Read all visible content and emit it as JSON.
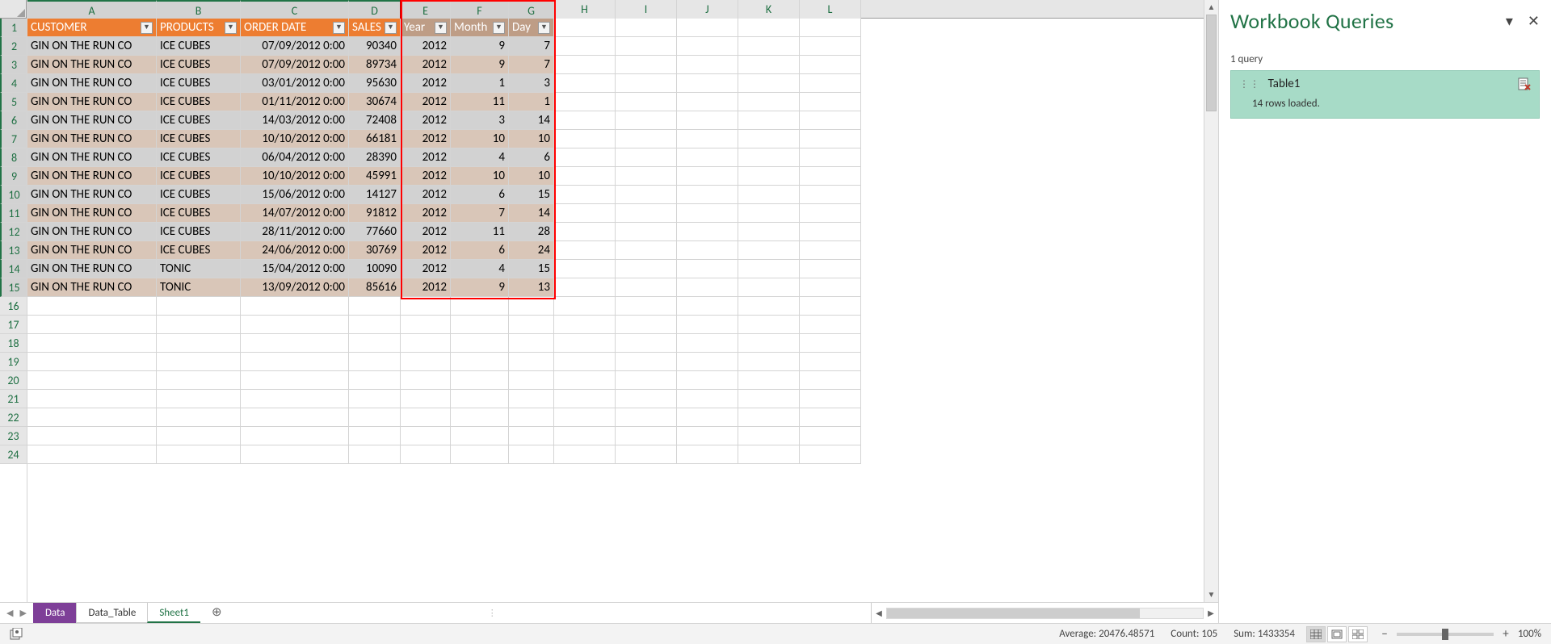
{
  "columns_labeled": [
    "A",
    "B",
    "C",
    "D",
    "E",
    "F",
    "G",
    "H",
    "I",
    "J",
    "K",
    "L"
  ],
  "row_numbers": [
    1,
    2,
    3,
    4,
    5,
    6,
    7,
    8,
    9,
    10,
    11,
    12,
    13,
    14,
    15,
    16,
    17,
    18,
    19,
    20,
    21,
    22,
    23,
    24
  ],
  "headers_orange": [
    "CUSTOMER",
    "PRODUCTS",
    "ORDER DATE",
    "SALES"
  ],
  "headers_brown": [
    "Year",
    "Month",
    "Day"
  ],
  "rows": [
    {
      "customer": "GIN ON THE RUN CO",
      "product": "ICE CUBES",
      "date": "07/09/2012 0:00",
      "sales": "90340",
      "year": "2012",
      "month": "9",
      "day": "7"
    },
    {
      "customer": "GIN ON THE RUN CO",
      "product": "ICE CUBES",
      "date": "07/09/2012 0:00",
      "sales": "89734",
      "year": "2012",
      "month": "9",
      "day": "7"
    },
    {
      "customer": "GIN ON THE RUN CO",
      "product": "ICE CUBES",
      "date": "03/01/2012 0:00",
      "sales": "95630",
      "year": "2012",
      "month": "1",
      "day": "3"
    },
    {
      "customer": "GIN ON THE RUN CO",
      "product": "ICE CUBES",
      "date": "01/11/2012 0:00",
      "sales": "30674",
      "year": "2012",
      "month": "11",
      "day": "1"
    },
    {
      "customer": "GIN ON THE RUN CO",
      "product": "ICE CUBES",
      "date": "14/03/2012 0:00",
      "sales": "72408",
      "year": "2012",
      "month": "3",
      "day": "14"
    },
    {
      "customer": "GIN ON THE RUN CO",
      "product": "ICE CUBES",
      "date": "10/10/2012 0:00",
      "sales": "66181",
      "year": "2012",
      "month": "10",
      "day": "10"
    },
    {
      "customer": "GIN ON THE RUN CO",
      "product": "ICE CUBES",
      "date": "06/04/2012 0:00",
      "sales": "28390",
      "year": "2012",
      "month": "4",
      "day": "6"
    },
    {
      "customer": "GIN ON THE RUN CO",
      "product": "ICE CUBES",
      "date": "10/10/2012 0:00",
      "sales": "45991",
      "year": "2012",
      "month": "10",
      "day": "10"
    },
    {
      "customer": "GIN ON THE RUN CO",
      "product": "ICE CUBES",
      "date": "15/06/2012 0:00",
      "sales": "14127",
      "year": "2012",
      "month": "6",
      "day": "15"
    },
    {
      "customer": "GIN ON THE RUN CO",
      "product": "ICE CUBES",
      "date": "14/07/2012 0:00",
      "sales": "91812",
      "year": "2012",
      "month": "7",
      "day": "14"
    },
    {
      "customer": "GIN ON THE RUN CO",
      "product": "ICE CUBES",
      "date": "28/11/2012 0:00",
      "sales": "77660",
      "year": "2012",
      "month": "11",
      "day": "28"
    },
    {
      "customer": "GIN ON THE RUN CO",
      "product": "ICE CUBES",
      "date": "24/06/2012 0:00",
      "sales": "30769",
      "year": "2012",
      "month": "6",
      "day": "24"
    },
    {
      "customer": "GIN ON THE RUN CO",
      "product": "TONIC",
      "date": "15/04/2012 0:00",
      "sales": "10090",
      "year": "2012",
      "month": "4",
      "day": "15"
    },
    {
      "customer": "GIN ON THE RUN CO",
      "product": "TONIC",
      "date": "13/09/2012 0:00",
      "sales": "85616",
      "year": "2012",
      "month": "9",
      "day": "13"
    }
  ],
  "sheet_tabs": {
    "data": "Data",
    "data_table": "Data_Table",
    "sheet1": "Sheet1"
  },
  "queries_panel": {
    "title": "Workbook Queries",
    "subtitle": "1 query",
    "item_name": "Table1",
    "item_status": "14 rows loaded."
  },
  "status_bar": {
    "average_label": "Average:",
    "average_value": "20476.48571",
    "count_label": "Count:",
    "count_value": "105",
    "sum_label": "Sum:",
    "sum_value": "1433354",
    "zoom": "100%"
  }
}
